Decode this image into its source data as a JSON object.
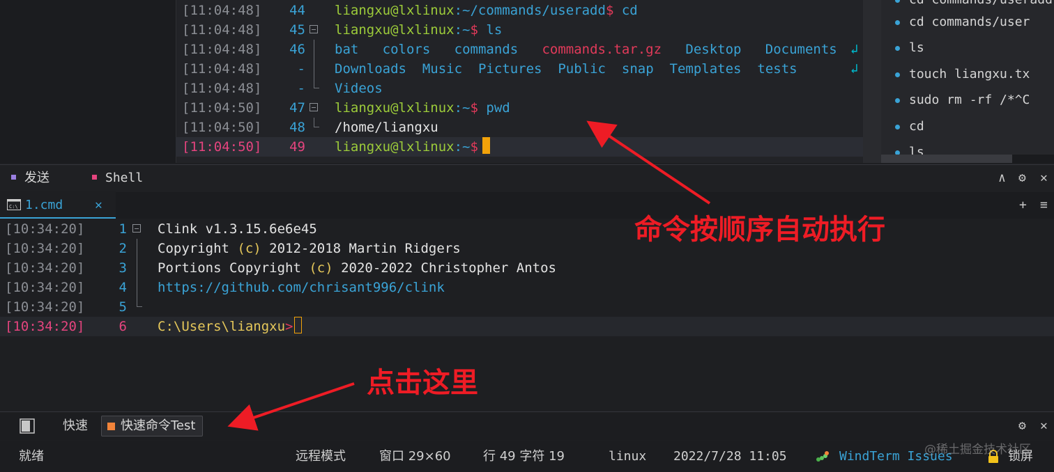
{
  "colors": {
    "accent": "#3aa3d6",
    "highlight": "#e5447e",
    "prompt_user": "#9ccb3a",
    "cursor": "#f2a20a",
    "annotation": "#ee1c25"
  },
  "top_terminal": {
    "lines": [
      {
        "ts": "[11:04:48]",
        "ln": "44",
        "user": "liangxu@lxlinux",
        "path": ":~/commands/useradd",
        "sym": "$",
        "cmd": " cd"
      },
      {
        "ts": "[11:04:48]",
        "ln": "45",
        "user": "liangxu@lxlinux",
        "path": ":~",
        "sym": "$",
        "cmd": " ls"
      },
      {
        "ts": "[11:04:48]",
        "ln": "46"
      },
      {
        "ts": "[11:04:48]",
        "ln": "-"
      },
      {
        "ts": "[11:04:48]",
        "ln": "-"
      },
      {
        "ts": "[11:04:50]",
        "ln": "47",
        "user": "liangxu@lxlinux",
        "path": ":~",
        "sym": "$",
        "cmd": " pwd"
      },
      {
        "ts": "[11:04:50]",
        "ln": "48",
        "out": "/home/liangxu"
      },
      {
        "ts": "[11:04:50]",
        "ln": "49",
        "user": "liangxu@lxlinux",
        "path": ":~",
        "sym": "$",
        "cmd": " "
      }
    ],
    "ls_row1": [
      "bat",
      "colors",
      "commands",
      "commands.tar.gz",
      "Desktop",
      "Documents"
    ],
    "ls_row2": [
      "Downloads",
      "Music",
      "Pictures",
      "Public",
      "snap",
      "Templates",
      "tests"
    ],
    "ls_row3": [
      "Videos"
    ],
    "wrap_glyph": "↲"
  },
  "history": {
    "items": [
      "cd commands/user",
      "ls",
      "touch liangxu.tx",
      "sudo rm -rf /*^C",
      "cd",
      "ls"
    ],
    "partial_top": "cd commands/useradd"
  },
  "panel_tabs": {
    "send": "发送",
    "shell": "Shell",
    "controls": {
      "up": "∧",
      "gear": "⚙",
      "close": "✕"
    }
  },
  "shell_tab": {
    "label": "1.cmd",
    "close": "✕",
    "add": "+",
    "menu": "≡"
  },
  "shell": {
    "lines": [
      {
        "ts": "[10:34:20]",
        "ln": "1",
        "text": "Clink v1.3.15.6e6e45"
      },
      {
        "ts": "[10:34:20]",
        "ln": "2",
        "a": "Copyright ",
        "b": "(c)",
        "c": " 2012-2018 Martin Ridgers"
      },
      {
        "ts": "[10:34:20]",
        "ln": "3",
        "a": "Portions Copyright ",
        "b": "(c)",
        "c": " 2020-2022 Christopher Antos"
      },
      {
        "ts": "[10:34:20]",
        "ln": "4",
        "text": "https://github.com/chrisant996/clink"
      },
      {
        "ts": "[10:34:20]",
        "ln": "5",
        "text": ""
      },
      {
        "ts": "[10:34:20]",
        "ln": "6",
        "text": "C:\\Users\\liangxu",
        "sym": ">"
      }
    ]
  },
  "quickbar": {
    "label": "快速",
    "command": "快速命令Test"
  },
  "status": {
    "ready": "就绪",
    "mode": "远程模式",
    "window": "窗口 29×60",
    "pos": "行 49 字符 19",
    "os": "linux",
    "datetime": "2022/7/28 11:05",
    "brand": "WindTerm Issues",
    "lock": "锁屏",
    "watermark": "@稀土掘金技术社区"
  },
  "annotations": {
    "auto": "命令按顺序自动执行",
    "click": "点击这里"
  }
}
